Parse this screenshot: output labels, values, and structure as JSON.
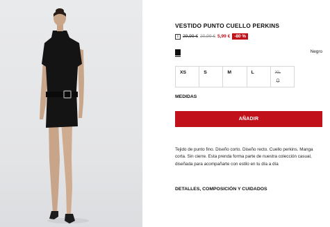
{
  "product": {
    "title": "VESTIDO PUNTO CUELLO PERKINS",
    "price": {
      "info_icon": "info-icon",
      "original": "29,99 €",
      "previous": "20,99 €",
      "current": "5,99 €",
      "discount": "-80 %"
    },
    "color": {
      "name": "Negro",
      "swatch": "#111111"
    },
    "sizes": [
      {
        "label": "XS",
        "available": true
      },
      {
        "label": "S",
        "available": true
      },
      {
        "label": "M",
        "available": true
      },
      {
        "label": "L",
        "available": true
      },
      {
        "label": "XL",
        "available": false,
        "icon": "bell-icon"
      }
    ],
    "size_guide_label": "MEDIDAS",
    "add_button_label": "AÑADIR",
    "description": "Tejido de punto fino. Diseño corto. Diseño recto. Cuello perkins. Manga corta. Sin cierre. Esta prenda forma parte de nuestra colección casual, diseñada para acompañarte con estilo en tu día a día",
    "details_label": "DETALLES, COMPOSICIÓN Y CUIDADOS"
  },
  "colors": {
    "accent": "#c1121b",
    "text": "#111111",
    "border": "#d7d7d7"
  }
}
